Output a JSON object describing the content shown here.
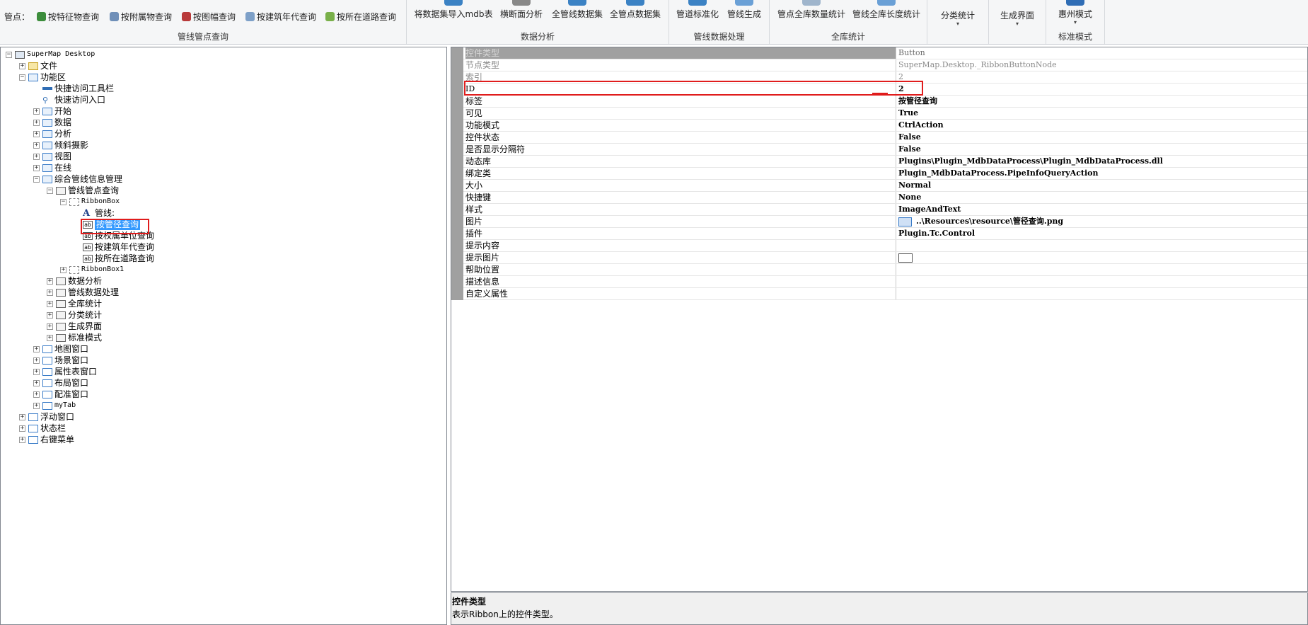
{
  "ribbon": {
    "prefix": "管点：",
    "query_buttons": [
      "按特征物查询",
      "按附属物查询",
      "按图幅查询",
      "按建筑年代查询",
      "按所在道路查询"
    ],
    "group_pipepoint_query": "管线管点查询",
    "analysis_buttons": [
      "将数据集导入mdb表",
      "横断面分析",
      "全管线数据集",
      "全管点数据集"
    ],
    "group_analysis": "数据分析",
    "processing_buttons": [
      "管道标准化",
      "管线生成"
    ],
    "group_processing": "管线数据处理",
    "stats_buttons": [
      "管点全库数量统计",
      "管线全库长度统计"
    ],
    "group_stats": "全库统计",
    "classify_button": "分类统计",
    "ui_button": "生成界面",
    "mode_button": "惠州模式",
    "group_mode": "标准模式"
  },
  "tree": {
    "root": "SuperMap Desktop",
    "file": "文件",
    "features": "功能区",
    "quick_access_toolbar": "快捷访问工具栏",
    "quick_access_entry": "快速访问入口",
    "start": "开始",
    "data": "数据",
    "analysis": "分析",
    "oblique": "倾斜摄影",
    "view": "视图",
    "online": "在线",
    "pipe_mgmt": "综合管线信息管理",
    "pipe_query": "管线管点查询",
    "ribbonbox": "RibbonBox",
    "pipe_label": "管线:",
    "by_diameter": "按管径查询",
    "by_unit": "按权属单位查询",
    "by_year": "按建筑年代查询",
    "by_road": "按所在道路查询",
    "ribbonbox1": "RibbonBox1",
    "data_analysis": "数据分析",
    "pipe_processing": "管线数据处理",
    "full_stats": "全库统计",
    "class_stats": "分类统计",
    "gen_ui": "生成界面",
    "std_mode": "标准模式",
    "map_window": "地图窗口",
    "scene_window": "场景窗口",
    "attr_window": "属性表窗口",
    "layout_window": "布局窗口",
    "register_window": "配准窗口",
    "mytab": "myTab",
    "float_window": "浮动窗口",
    "statusbar": "状态栏",
    "context_menu": "右键菜单"
  },
  "properties": [
    {
      "name": "控件类型",
      "value": "Button"
    },
    {
      "name": "节点类型",
      "value": "SuperMap.Desktop._RibbonButtonNode"
    },
    {
      "name": "索引",
      "value": "2"
    },
    {
      "name": "ID",
      "value": "2"
    },
    {
      "name": "标签",
      "value": "按管径查询"
    },
    {
      "name": "可见",
      "value": "True"
    },
    {
      "name": "功能模式",
      "value": "CtrlAction"
    },
    {
      "name": "控件状态",
      "value": "False"
    },
    {
      "name": "是否显示分隔符",
      "value": "False"
    },
    {
      "name": "动态库",
      "value": "Plugins\\Plugin_MdbDataProcess\\Plugin_MdbDataProcess.dll"
    },
    {
      "name": "绑定类",
      "value": "Plugin_MdbDataProcess.PipeInfoQueryAction"
    },
    {
      "name": "大小",
      "value": "Normal"
    },
    {
      "name": "快捷键",
      "value": "None"
    },
    {
      "name": "样式",
      "value": "ImageAndText"
    },
    {
      "name": "图片",
      "value": "..\\Resources\\resource\\管径查询.png"
    },
    {
      "name": "插件",
      "value": "Plugin.Tc.Control"
    },
    {
      "name": "提示内容",
      "value": ""
    },
    {
      "name": "提示图片",
      "value": ""
    },
    {
      "name": "帮助位置",
      "value": ""
    },
    {
      "name": "描述信息",
      "value": ""
    },
    {
      "name": "自定义属性",
      "value": ""
    }
  ],
  "description": {
    "title": "控件类型",
    "text": "表示Ribbon上的控件类型。"
  },
  "colors": {
    "selection": "#3399ff",
    "highlight_box": "#e01c1c",
    "grid_margin": "#a0a0a0"
  }
}
